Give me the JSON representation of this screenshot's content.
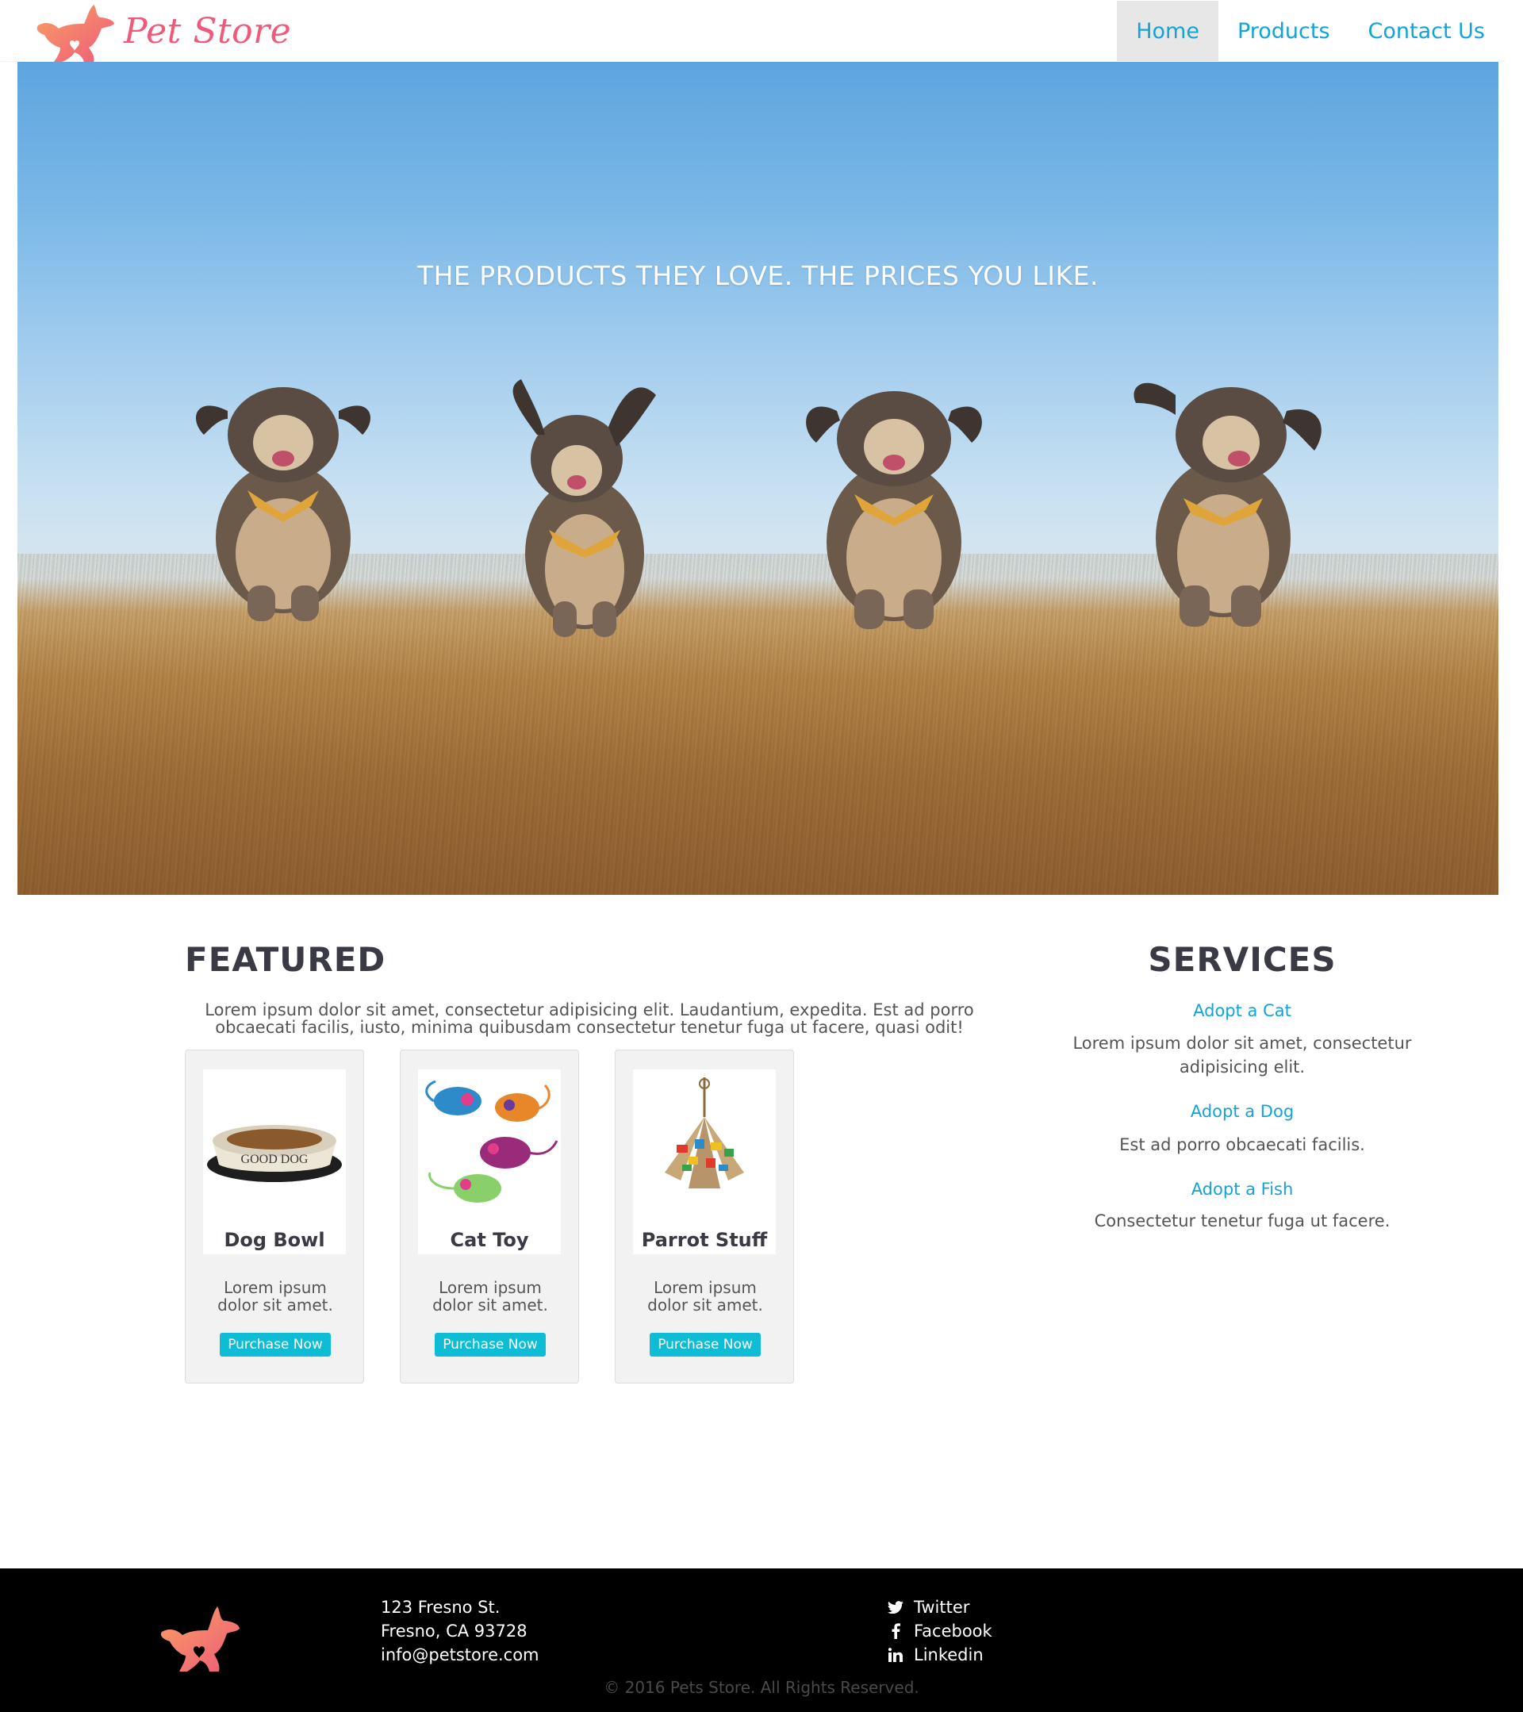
{
  "brand": {
    "name": "Pet Store",
    "logo_icon": "running-dog-logo-icon",
    "color": "#ef5a7a"
  },
  "nav": {
    "items": [
      {
        "label": "Home",
        "active": true
      },
      {
        "label": "Products",
        "active": false
      },
      {
        "label": "Contact Us",
        "active": false
      }
    ],
    "link_color": "#12a3d8",
    "active_bg": "#e7e7e7"
  },
  "hero": {
    "title": "THE PRODUCTS THEY LOVE. THE PRICES YOU LIKE."
  },
  "featured": {
    "title": "FEATURED",
    "text": "Lorem ipsum dolor sit amet, consectetur adipisicing elit. Laudantium, expedita. Est ad porro obcaecati facilis, iusto, minima quibusdam consectetur tenetur fuga ut facere, quasi odit!",
    "products": [
      {
        "name": "Dog Bowl",
        "desc": "Lorem ipsum dolor sit amet.",
        "button": "Purchase Now",
        "image_label": "GOOD DOG"
      },
      {
        "name": "Cat Toy",
        "desc": "Lorem ipsum dolor sit amet.",
        "button": "Purchase Now"
      },
      {
        "name": "Parrot Stuff",
        "desc": "Lorem ipsum dolor sit amet.",
        "button": "Purchase Now"
      }
    ],
    "button_color": "#0fbcd6"
  },
  "services": {
    "title": "SERVICES",
    "items": [
      {
        "link": "Adopt a Cat",
        "desc": "Lorem ipsum dolor sit amet, consectetur adipisicing elit."
      },
      {
        "link": "Adopt a Dog",
        "desc": "Est ad porro obcaecati facilis."
      },
      {
        "link": "Adopt a Fish",
        "desc": "Consectetur tenetur fuga ut facere."
      }
    ]
  },
  "footer": {
    "address": [
      "123 Fresno St.",
      "Fresno, CA 93728",
      "info@petstore.com"
    ],
    "social": [
      {
        "label": "Twitter",
        "icon": "twitter-icon"
      },
      {
        "label": "Facebook",
        "icon": "facebook-icon"
      },
      {
        "label": "Linkedin",
        "icon": "linkedin-icon"
      }
    ],
    "copyright": "© 2016 Pets Store. All Rights Reserved."
  }
}
